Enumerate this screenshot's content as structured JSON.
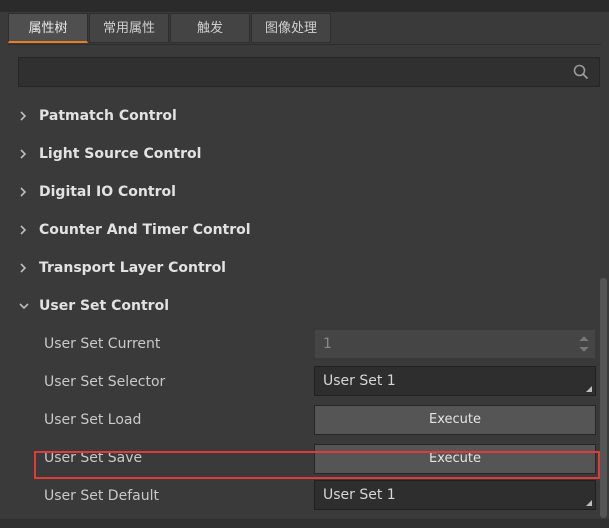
{
  "tabs": [
    {
      "label": "属性树",
      "active": true
    },
    {
      "label": "常用属性",
      "active": false
    },
    {
      "label": "触发",
      "active": false
    },
    {
      "label": "图像处理",
      "active": false
    }
  ],
  "search": {
    "icon": "search-icon",
    "value": ""
  },
  "sections": [
    {
      "label": "Patmatch Control",
      "expanded": false
    },
    {
      "label": "Light Source Control",
      "expanded": false
    },
    {
      "label": "Digital IO Control",
      "expanded": false
    },
    {
      "label": "Counter And Timer Control",
      "expanded": false
    },
    {
      "label": "Transport Layer Control",
      "expanded": false
    },
    {
      "label": "User Set Control",
      "expanded": true
    }
  ],
  "user_set": {
    "current": {
      "label": "User Set Current",
      "value": "1"
    },
    "selector": {
      "label": "User Set Selector",
      "value": "User Set 1"
    },
    "load": {
      "label": "User Set Load",
      "button": "Execute"
    },
    "save": {
      "label": "User Set Save",
      "button": "Execute"
    },
    "default": {
      "label": "User Set Default",
      "value": "User Set 1"
    }
  },
  "colors": {
    "accent": "#e67e22",
    "highlight": "#e03b3b"
  }
}
